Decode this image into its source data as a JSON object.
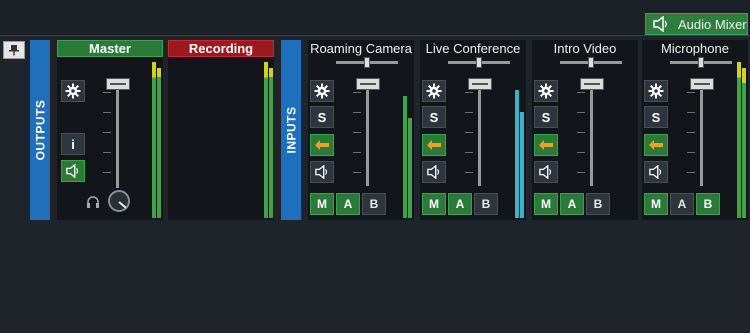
{
  "window": {
    "tab_label": "Audio Mixer"
  },
  "outputs": {
    "section_label": "OUTPUTS",
    "master": {
      "title": "Master",
      "info_label": "i"
    },
    "recording": {
      "title": "Recording"
    }
  },
  "inputs": {
    "section_label": "INPUTS",
    "channels": [
      {
        "name": "Roaming Camera",
        "solo_label": "S",
        "bus": [
          {
            "label": "M",
            "on": true
          },
          {
            "label": "A",
            "on": true
          },
          {
            "label": "B",
            "on": false
          }
        ]
      },
      {
        "name": "Live Conference",
        "solo_label": "S",
        "bus": [
          {
            "label": "M",
            "on": true
          },
          {
            "label": "A",
            "on": true
          },
          {
            "label": "B",
            "on": false
          }
        ]
      },
      {
        "name": "Intro Video",
        "solo_label": "S",
        "bus": [
          {
            "label": "M",
            "on": true
          },
          {
            "label": "A",
            "on": true
          },
          {
            "label": "B",
            "on": false
          }
        ]
      },
      {
        "name": "Microphone",
        "solo_label": "S",
        "bus": [
          {
            "label": "M",
            "on": true
          },
          {
            "label": "A",
            "on": false
          },
          {
            "label": "B",
            "on": true
          }
        ]
      }
    ]
  },
  "colors": {
    "accent_green": "#2b7a3a",
    "recording_red": "#9c1a1f",
    "section_blue": "#1f6fba",
    "meter_green": "#3fa34a",
    "meter_yellow": "#d8d020",
    "meter_teal": "#3ab4c4",
    "route_orange": "#f0a020"
  },
  "icons": {
    "settings": "gear-icon",
    "speaker": "speaker-icon",
    "route": "arrow-left-icon",
    "headphones": "headphones-icon",
    "pin": "pin-icon"
  }
}
